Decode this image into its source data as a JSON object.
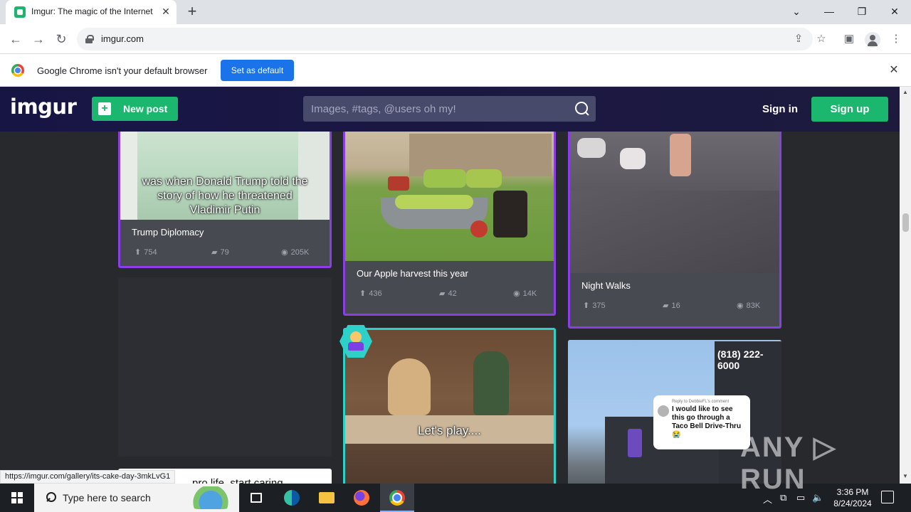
{
  "browser": {
    "tab_title": "Imgur: The magic of the Internet",
    "url": "imgur.com",
    "infobar_text": "Google Chrome isn't your default browser",
    "set_default_label": "Set as default",
    "status_url": "https://imgur.com/gallery/its-cake-day-3mkLvG1"
  },
  "header": {
    "logo": "imgur",
    "new_post_label": "New post",
    "search_placeholder": "Images, #tags, @users oh my!",
    "sign_in": "Sign in",
    "sign_up": "Sign up"
  },
  "posts": [
    {
      "title": "Trump Diplomacy",
      "overlay": "was when Donald Trump told the story of how he threatened Vladimir Putin",
      "upvotes": "754",
      "comments": "79",
      "views": "205K"
    },
    {
      "title": "Our Apple harvest this year",
      "upvotes": "436",
      "comments": "42",
      "views": "14K"
    },
    {
      "title": "Night Walks",
      "upvotes": "375",
      "comments": "16",
      "views": "83K"
    },
    {
      "overlay": "Let's play...."
    },
    {
      "overlay_header": "Reply to DebbieFL's comment",
      "overlay": "I would like to see this go through a Taco Bell Drive-Thru 😭",
      "phone": "(818) 222-6000"
    },
    {
      "partial_text": "pro life, start caring"
    }
  ],
  "taskbar": {
    "search_placeholder": "Type here to search",
    "time": "3:36 PM",
    "date": "8/24/2024"
  },
  "watermark": "ANY ▷ RUN",
  "colors": {
    "imgur_green": "#1bb76e",
    "header_bg": "#171544",
    "purple_border": "#8a3ee6",
    "teal_border": "#2ed1c9"
  }
}
